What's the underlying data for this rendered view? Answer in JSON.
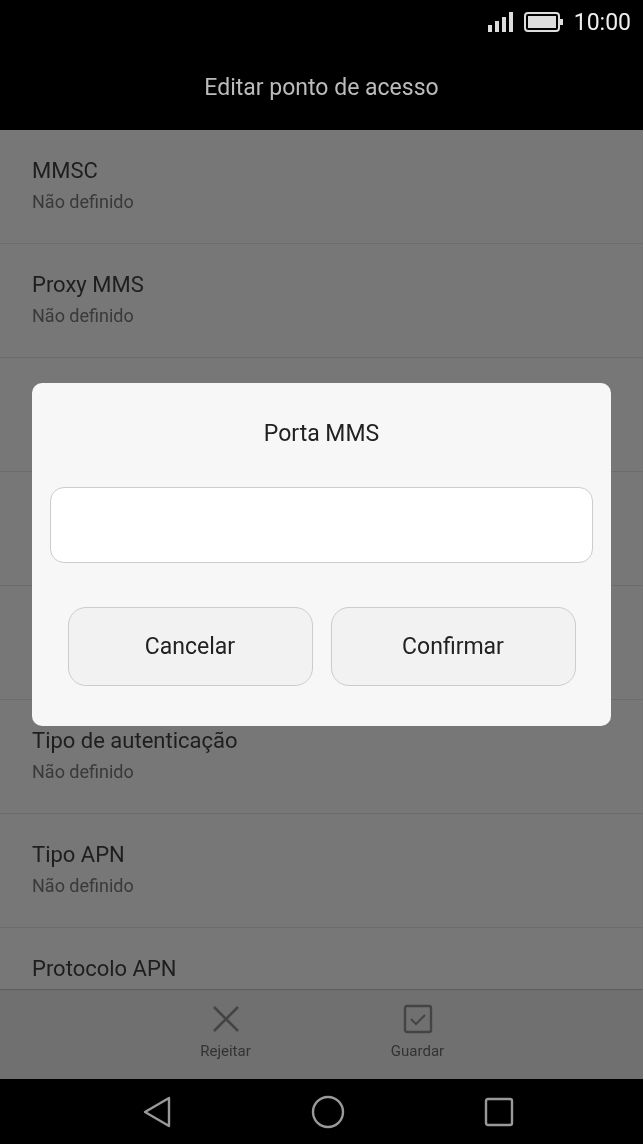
{
  "status_bar": {
    "time": "10:00"
  },
  "title_bar": {
    "title": "Editar ponto de acesso"
  },
  "settings": [
    {
      "kind": "entry",
      "title": "MMSC",
      "value": "Não definido"
    },
    {
      "kind": "entry",
      "title": "Proxy MMS",
      "value": "Não definido"
    },
    {
      "kind": "covered"
    },
    {
      "kind": "covered"
    },
    {
      "kind": "covered"
    },
    {
      "kind": "entry",
      "title": "Tipo de autenticação",
      "value": "Não definido"
    },
    {
      "kind": "entry",
      "title": "Tipo APN",
      "value": "Não definido"
    },
    {
      "kind": "entry",
      "title": "Protocolo APN"
    }
  ],
  "bottom_actions": [
    {
      "kind": "reject",
      "label": "Rejeitar"
    },
    {
      "kind": "save",
      "label": "Guardar"
    }
  ],
  "dialog": {
    "title": "Porta MMS",
    "buttons": [
      "Cancelar",
      "Confirmar"
    ]
  }
}
